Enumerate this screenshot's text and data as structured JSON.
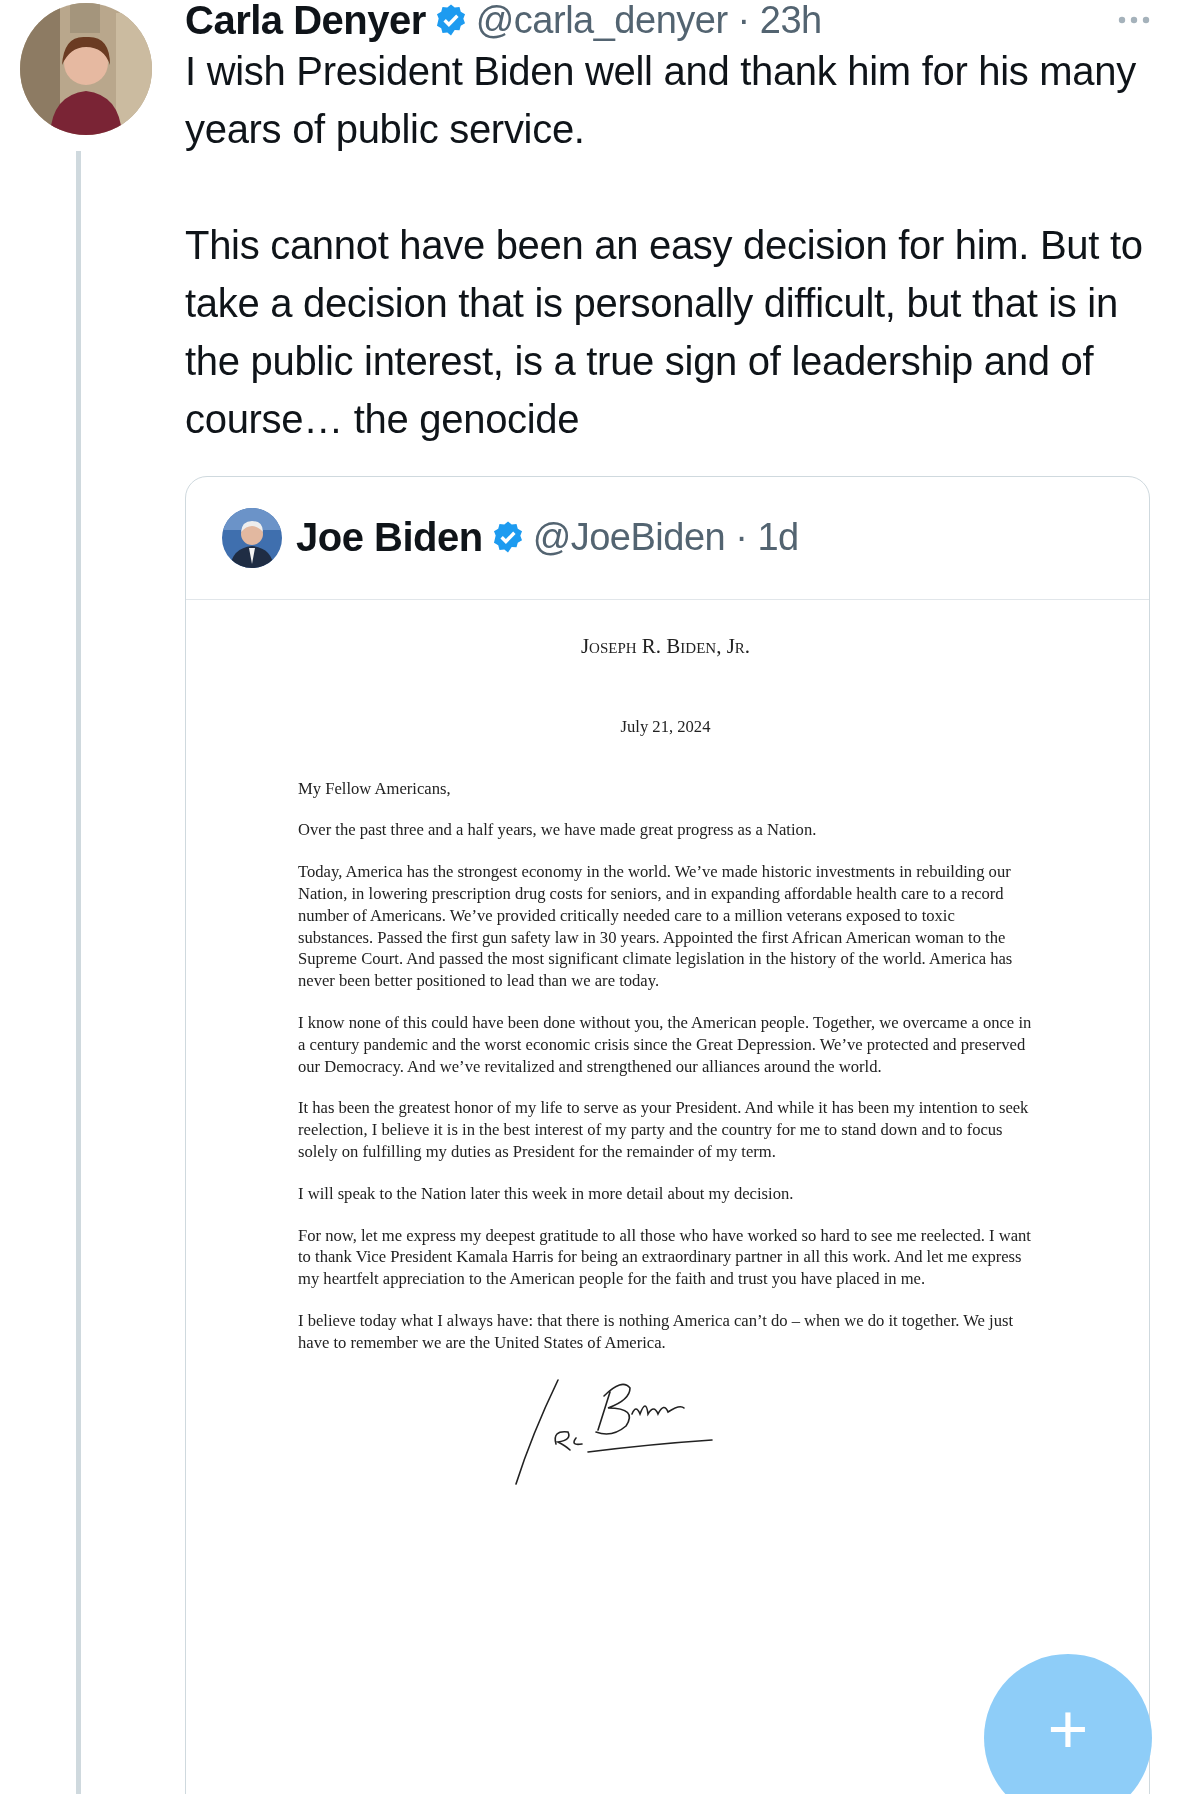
{
  "tweet": {
    "author": {
      "name": "Carla Denyer",
      "verified": true,
      "meta": "@carla_denyer · 23h"
    },
    "paragraphs": [
      "I wish President Biden well and thank him for his many years of public service.",
      "This cannot have been an easy decision for him. But to take a decision that is personally difficult, but that is in the public interest, is a true sign of leadership  and of course… the genocide"
    ],
    "quote": {
      "author": {
        "name": "Joe Biden",
        "verified": true,
        "meta": "@JoeBiden · 1d"
      },
      "letter": {
        "heading": "Joseph R. Biden, Jr.",
        "date": "July 21, 2024",
        "salutation": "My Fellow Americans,",
        "paragraphs": [
          "Over the past three and a half years, we have made great progress as a Nation.",
          "Today, America has the strongest economy in the world. We’ve made historic investments in rebuilding our Nation, in lowering prescription drug costs for seniors, and in expanding affordable health care to a record number of Americans. We’ve provided critically needed care to a million veterans exposed to toxic substances. Passed the first gun safety law in 30 years. Appointed the first African American woman to the Supreme Court. And passed the most significant climate legislation in the history of the world. America has never been better positioned to lead than we are today.",
          "I know none of this could have been done without you, the American people. Together, we overcame a once in a century pandemic and the worst economic crisis since the Great Depression. We’ve protected and preserved our Democracy. And we’ve revitalized and strengthened our alliances around the world.",
          "It has been the greatest honor of my life to serve as your President. And while it has been my intention to seek reelection, I believe it is in the best interest of my party and the country for me to stand down and to focus solely on fulfilling my duties as President for the remainder of my term.",
          "I will speak to the Nation later this week in more detail about my decision.",
          "For now, let me express my deepest gratitude to all those who have worked so hard to see me reelected. I want to thank Vice President Kamala Harris for being an extraordinary partner in all this work. And let me express my heartfelt appreciation to the American people for the faith and trust you have placed in me.",
          "I believe today what I always have: that there is nothing America can’t do – when we do it together. We just have to remember we are the United States of America."
        ]
      }
    }
  },
  "fab": {
    "label": "+"
  }
}
